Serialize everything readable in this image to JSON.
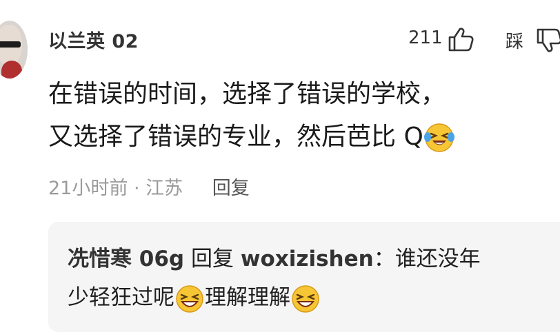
{
  "comment": {
    "username": "以兰英 02",
    "like_count": "211",
    "dislike_label": "踩",
    "text_line1": "在错误的时间，选择了错误的学校，",
    "text_line2": "又选择了错误的专业，然后芭比 Q",
    "emoji": "crying-laughing",
    "time": "21小时前",
    "separator": "·",
    "location": "江苏",
    "reply_action": "回复"
  },
  "reply": {
    "author": "冼惜寒 06g",
    "reply_word": "回复",
    "target": "woxizishen",
    "colon": "：",
    "text_part1": "谁还没年",
    "text_line2_part1": "少轻狂过呢",
    "text_line2_part2": "理解理解",
    "emoji": "grinning-squint"
  },
  "colors": {
    "text_primary": "#1a1a1a",
    "text_secondary": "#9a9a9a",
    "reply_bg": "#f5f5f5"
  }
}
